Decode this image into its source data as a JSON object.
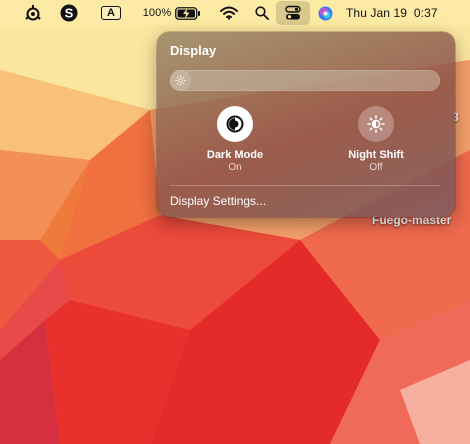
{
  "menubar": {
    "input_source": "A",
    "battery_percent": "100%",
    "clock": "Thu Jan 19  0:37",
    "icons": [
      "steelseries-icon",
      "app-s-icon",
      "input-source-icon",
      "battery-charging-icon",
      "wifi-icon",
      "spotlight-search-icon",
      "control-center-icon",
      "siri-icon"
    ]
  },
  "desktop": {
    "icon_label": "Fuego-master",
    "partial_label": "3"
  },
  "display_panel": {
    "title": "Display",
    "brightness": 0.02,
    "dark_mode": {
      "label": "Dark Mode",
      "state": "On"
    },
    "night_shift": {
      "label": "Night Shift",
      "state": "Off"
    },
    "settings_link": "Display Settings..."
  },
  "colors": {
    "menubar_bg": "#F7E7A6",
    "panel_bg": "#8E6458",
    "wallpaper_red": "#E8342E",
    "wallpaper_orange": "#F28A3A"
  }
}
